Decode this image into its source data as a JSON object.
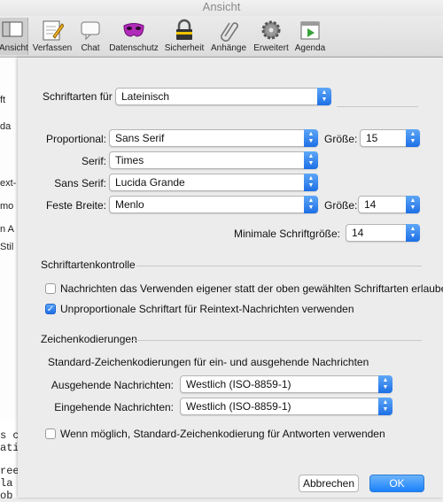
{
  "window": {
    "title": "Ansicht"
  },
  "toolbar": {
    "items": [
      {
        "label": "Ansicht",
        "icon": "window-view-icon"
      },
      {
        "label": "Verfassen",
        "icon": "compose-pencil-icon"
      },
      {
        "label": "Chat",
        "icon": "chat-bubble-icon"
      },
      {
        "label": "Datenschutz",
        "icon": "privacy-mask-icon"
      },
      {
        "label": "Sicherheit",
        "icon": "padlock-icon"
      },
      {
        "label": "Anhänge",
        "icon": "paperclip-icon"
      },
      {
        "label": "Erweitert",
        "icon": "gear-icon"
      },
      {
        "label": "Agenda",
        "icon": "calendar-icon"
      }
    ]
  },
  "background_text": {
    "lines": [
      "ft",
      "da",
      "ext-",
      "mo",
      "n A",
      "Stil"
    ],
    "mono_lines": [
      "s c",
      "ati",
      "ree",
      "la",
      "ob"
    ]
  },
  "fonts": {
    "schriftarten_fuer_label": "Schriftarten für",
    "script_value": "Lateinisch",
    "proportional_label": "Proportional:",
    "proportional_value": "Sans Serif",
    "groesse_label": "Größe:",
    "proportional_size": "15",
    "serif_label": "Serif:",
    "serif_value": "Times",
    "sans_serif_label": "Sans Serif:",
    "sans_serif_value": "Lucida Grande",
    "monospace_label": "Feste Breite:",
    "monospace_value": "Menlo",
    "monospace_size": "14",
    "min_size_label": "Minimale Schriftgröße:",
    "min_size_value": "14"
  },
  "font_control": {
    "heading": "Schriftartenkontrolle",
    "allow_own_fonts": {
      "label": "Nachrichten das Verwenden eigener statt der oben gewählten Schriftarten erlauben",
      "checked": false
    },
    "proportional_plaintext": {
      "label": "Unproportionale Schriftart für Reintext-Nachrichten verwenden",
      "checked": true
    }
  },
  "encoding": {
    "heading": "Zeichenkodierungen",
    "description": "Standard-Zeichenkodierungen für ein- und ausgehende Nachrichten",
    "outgoing_label": "Ausgehende Nachrichten:",
    "outgoing_value": "Westlich (ISO-8859-1)",
    "incoming_label": "Eingehende Nachrichten:",
    "incoming_value": "Westlich (ISO-8859-1)",
    "reply_default": {
      "label": "Wenn möglich, Standard-Zeichenkodierung für Antworten verwenden",
      "checked": false
    }
  },
  "buttons": {
    "cancel": "Abbrechen",
    "ok": "OK"
  },
  "colors": {
    "accent": "#1d6fe6",
    "ok_button": "#1a82fb"
  }
}
